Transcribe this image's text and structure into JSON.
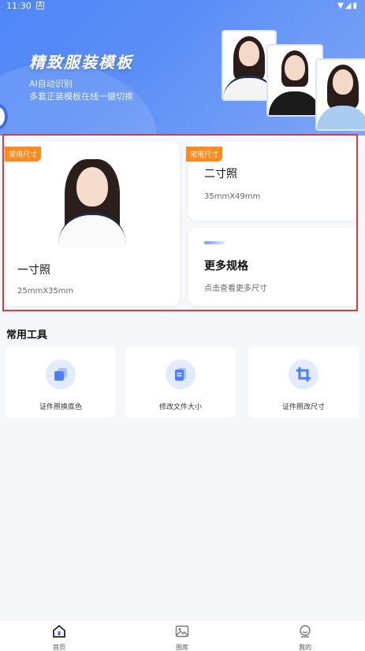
{
  "status_bar": {
    "time": "11:30",
    "notification_letter": "A"
  },
  "banner": {
    "title": "精致服装模板",
    "subtitle_line1": "AI自动识别",
    "subtitle_line2": "多套正装模板在线一键切换",
    "pager_count": 3,
    "active_page": 1
  },
  "cards": {
    "one_inch": {
      "tag": "常用尺寸",
      "title": "一寸照",
      "size": "25mmX35mm"
    },
    "two_inch": {
      "tag": "常用尺寸",
      "title": "二寸照",
      "size": "35mmX49mm"
    },
    "more": {
      "title": "更多规格",
      "subtitle": "点击查看更多尺寸"
    }
  },
  "tools": {
    "title": "常用工具",
    "items": [
      {
        "label": "证件照换底色",
        "icon": "layers-icon"
      },
      {
        "label": "修改文件大小",
        "icon": "document-icon"
      },
      {
        "label": "证件照改尺寸",
        "icon": "crop-icon"
      }
    ]
  },
  "nav": {
    "items": [
      {
        "label": "首页",
        "icon": "home-icon"
      },
      {
        "label": "图库",
        "icon": "gallery-icon"
      },
      {
        "label": "我的",
        "icon": "profile-icon"
      }
    ]
  },
  "colors": {
    "accent": "#2f6bff",
    "tag": "#ff8a1e",
    "highlight": "#e23a3a"
  }
}
